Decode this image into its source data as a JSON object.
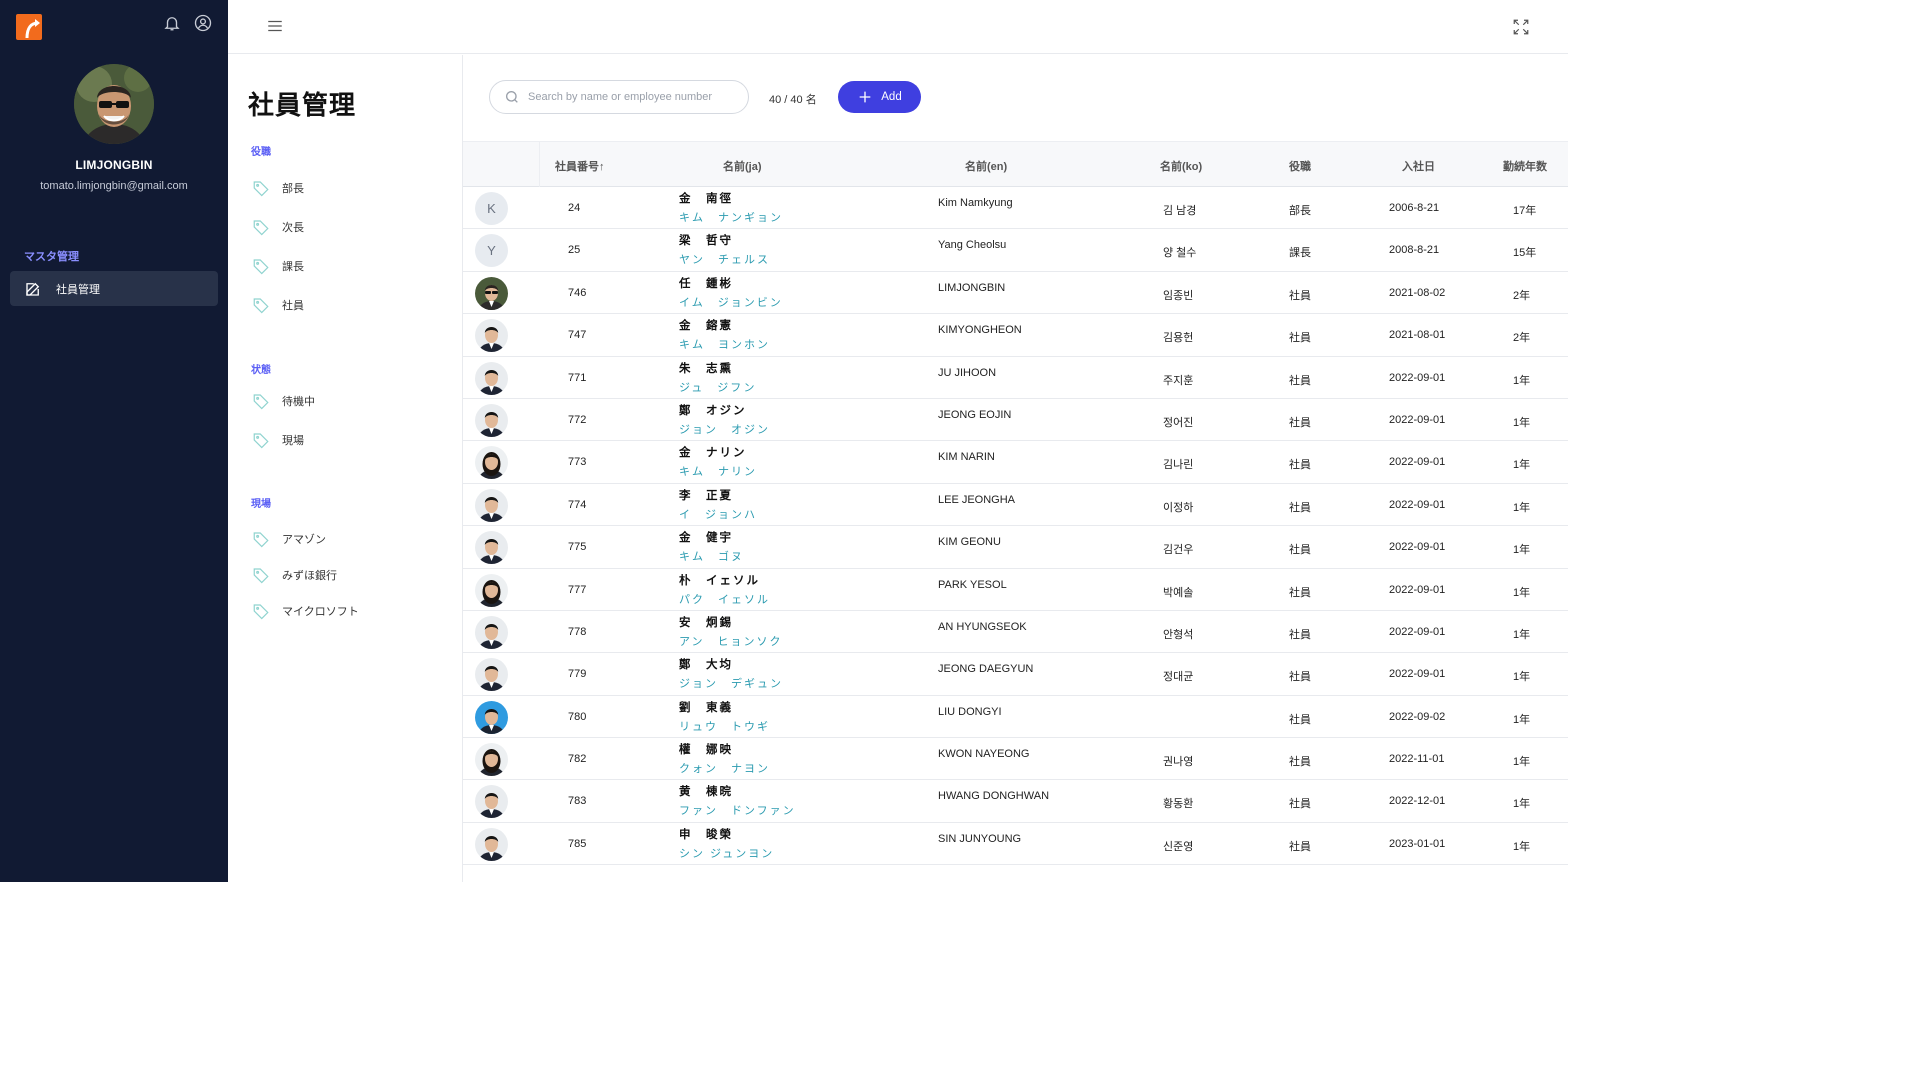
{
  "sidebar": {
    "username": "LIMJONGBIN",
    "email": "tomato.limjongbin@gmail.com",
    "section_label": "マスタ管理",
    "active_item": "社員管理",
    "colors": {
      "bg": "#111a33",
      "accent": "#8a8fff",
      "logo": "#f26b1d"
    }
  },
  "page": {
    "title": "社員管理",
    "filters": [
      {
        "group": "役職",
        "items": [
          "部長",
          "次長",
          "課長",
          "社員"
        ]
      },
      {
        "group": "状態",
        "items": [
          "待機中",
          "現場"
        ]
      },
      {
        "group": "現場",
        "items": [
          "アマゾン",
          "みずほ銀行",
          "マイクロソフト"
        ]
      }
    ]
  },
  "toolbar": {
    "search_placeholder": "Search by name or employee number",
    "count": "40 / 40 名",
    "add_label": "Add",
    "accent": "#3f3fe0"
  },
  "table": {
    "headers": [
      "社員番号↑",
      "名前(ja)",
      "名前(en)",
      "名前(ko)",
      "役職",
      "入社日",
      "勤続年数"
    ],
    "rows": [
      {
        "avatar": "K",
        "id": "24",
        "ja": "金　南徑",
        "kana": "キム　ナンギョン",
        "en": "Kim Namkyung",
        "ko": "김 남경",
        "role": "部長",
        "joined": "2006-8-21",
        "years": "17年"
      },
      {
        "avatar": "Y",
        "id": "25",
        "ja": "梁　哲守",
        "kana": "ヤン　チェルス",
        "en": "Yang Cheolsu",
        "ko": "양 철수",
        "role": "課長",
        "joined": "2008-8-21",
        "years": "15年"
      },
      {
        "avatar": "photo-sunglasses",
        "id": "746",
        "ja": "任　鍾彬",
        "kana": "イム　ジョンビン",
        "en": "LIMJONGBIN",
        "ko": "임종빈",
        "role": "社員",
        "joined": "2021-08-02",
        "years": "2年"
      },
      {
        "avatar": "photo",
        "id": "747",
        "ja": "金　鎔憲",
        "kana": "キム　ヨンホン",
        "en": "KIMYONGHEON",
        "ko": "김용헌",
        "role": "社員",
        "joined": "2021-08-01",
        "years": "2年"
      },
      {
        "avatar": "photo",
        "id": "771",
        "ja": "朱　志熏",
        "kana": "ジュ　ジフン",
        "en": "JU JIHOON",
        "ko": "주지훈",
        "role": "社員",
        "joined": "2022-09-01",
        "years": "1年"
      },
      {
        "avatar": "photo",
        "id": "772",
        "ja": "鄭　オジン",
        "kana": "ジョン　オジン",
        "en": "JEONG EOJIN",
        "ko": "정어진",
        "role": "社員",
        "joined": "2022-09-01",
        "years": "1年"
      },
      {
        "avatar": "photo-f",
        "id": "773",
        "ja": "金　ナリン",
        "kana": "キム　ナリン",
        "en": "KIM NARIN",
        "ko": "김나린",
        "role": "社員",
        "joined": "2022-09-01",
        "years": "1年"
      },
      {
        "avatar": "photo",
        "id": "774",
        "ja": "李　正夏",
        "kana": "イ　ジョンハ",
        "en": "LEE JEONGHA",
        "ko": "이정하",
        "role": "社員",
        "joined": "2022-09-01",
        "years": "1年"
      },
      {
        "avatar": "photo",
        "id": "775",
        "ja": "金　健宇",
        "kana": "キム　ゴヌ",
        "en": "KIM GEONU",
        "ko": "김건우",
        "role": "社員",
        "joined": "2022-09-01",
        "years": "1年"
      },
      {
        "avatar": "photo-f",
        "id": "777",
        "ja": "朴　イェソル",
        "kana": "パク　イェソル",
        "en": "PARK YESOL",
        "ko": "박예솔",
        "role": "社員",
        "joined": "2022-09-01",
        "years": "1年"
      },
      {
        "avatar": "photo",
        "id": "778",
        "ja": "安　炯錫",
        "kana": "アン　ヒョンソク",
        "en": "AN HYUNGSEOK",
        "ko": "안형석",
        "role": "社員",
        "joined": "2022-09-01",
        "years": "1年"
      },
      {
        "avatar": "photo",
        "id": "779",
        "ja": "鄭　大均",
        "kana": "ジョン　デギュン",
        "en": "JEONG DAEGYUN",
        "ko": "정대균",
        "role": "社員",
        "joined": "2022-09-01",
        "years": "1年"
      },
      {
        "avatar": "photo-blue",
        "id": "780",
        "ja": "劉　東義",
        "kana": "リュウ　トウギ",
        "en": "LIU DONGYI",
        "ko": "",
        "role": "社員",
        "joined": "2022-09-02",
        "years": "1年"
      },
      {
        "avatar": "photo-f",
        "id": "782",
        "ja": "權　娜映",
        "kana": "クォン　ナヨン",
        "en": "KWON NAYEONG",
        "ko": "권나영",
        "role": "社員",
        "joined": "2022-11-01",
        "years": "1年"
      },
      {
        "avatar": "photo",
        "id": "783",
        "ja": "黄　棟晥",
        "kana": "ファン　ドンファン",
        "en": "HWANG DONGHWAN",
        "ko": "황동환",
        "role": "社員",
        "joined": "2022-12-01",
        "years": "1年"
      },
      {
        "avatar": "photo",
        "id": "785",
        "ja": "申　晙榮",
        "kana": "シン ジュンヨン",
        "en": "SIN JUNYOUNG",
        "ko": "신준영",
        "role": "社員",
        "joined": "2023-01-01",
        "years": "1年"
      }
    ]
  }
}
